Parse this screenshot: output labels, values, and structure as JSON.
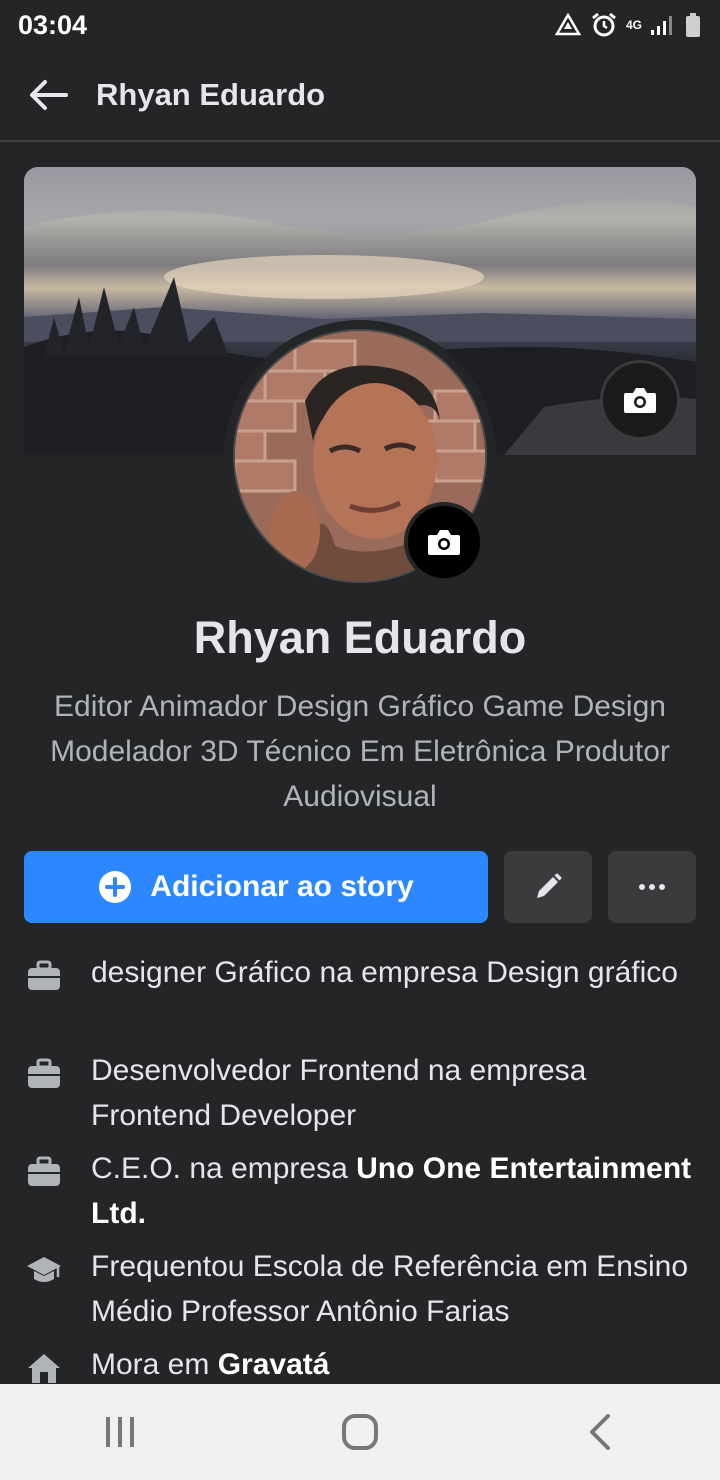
{
  "status_bar": {
    "time": "03:04",
    "network": "4G",
    "icons": [
      "data-saver-icon",
      "alarm-icon",
      "signal-icon",
      "battery-icon"
    ]
  },
  "header": {
    "title": "Rhyan Eduardo",
    "back_icon": "arrow-left-icon"
  },
  "profile": {
    "name": "Rhyan Eduardo",
    "bio": "Editor Animador Design Gráfico Game Design Modelador 3D Técnico Em Eletrônica Produtor Audiovisual"
  },
  "actions": {
    "add_story_label": "Adicionar ao story",
    "edit_icon": "pencil-icon",
    "more_icon": "more-dots-icon"
  },
  "details": [
    {
      "icon": "briefcase-icon",
      "text": "designer Gráfico na empresa Design gráfico",
      "bold": ""
    },
    {
      "icon": "briefcase-icon",
      "text": "Desenvolvedor Frontend na empresa Frontend Developer",
      "bold": ""
    },
    {
      "icon": "briefcase-icon",
      "text": "C.E.O. na empresa ",
      "bold": "Uno One Entertainment Ltd."
    },
    {
      "icon": "graduation-cap-icon",
      "text": "Frequentou Escola de Referência em Ensino Médio Professor Antônio Farias",
      "bold": ""
    },
    {
      "icon": "home-icon",
      "text": "Mora em ",
      "bold": "Gravatá"
    }
  ],
  "nav": {
    "icons": [
      "recent-apps-icon",
      "home-button-icon",
      "back-nav-icon"
    ]
  },
  "colors": {
    "background": "#242526",
    "accent": "#2d88ff",
    "secondary_button": "#3a3b3c",
    "muted_text": "#b0b3b8"
  }
}
